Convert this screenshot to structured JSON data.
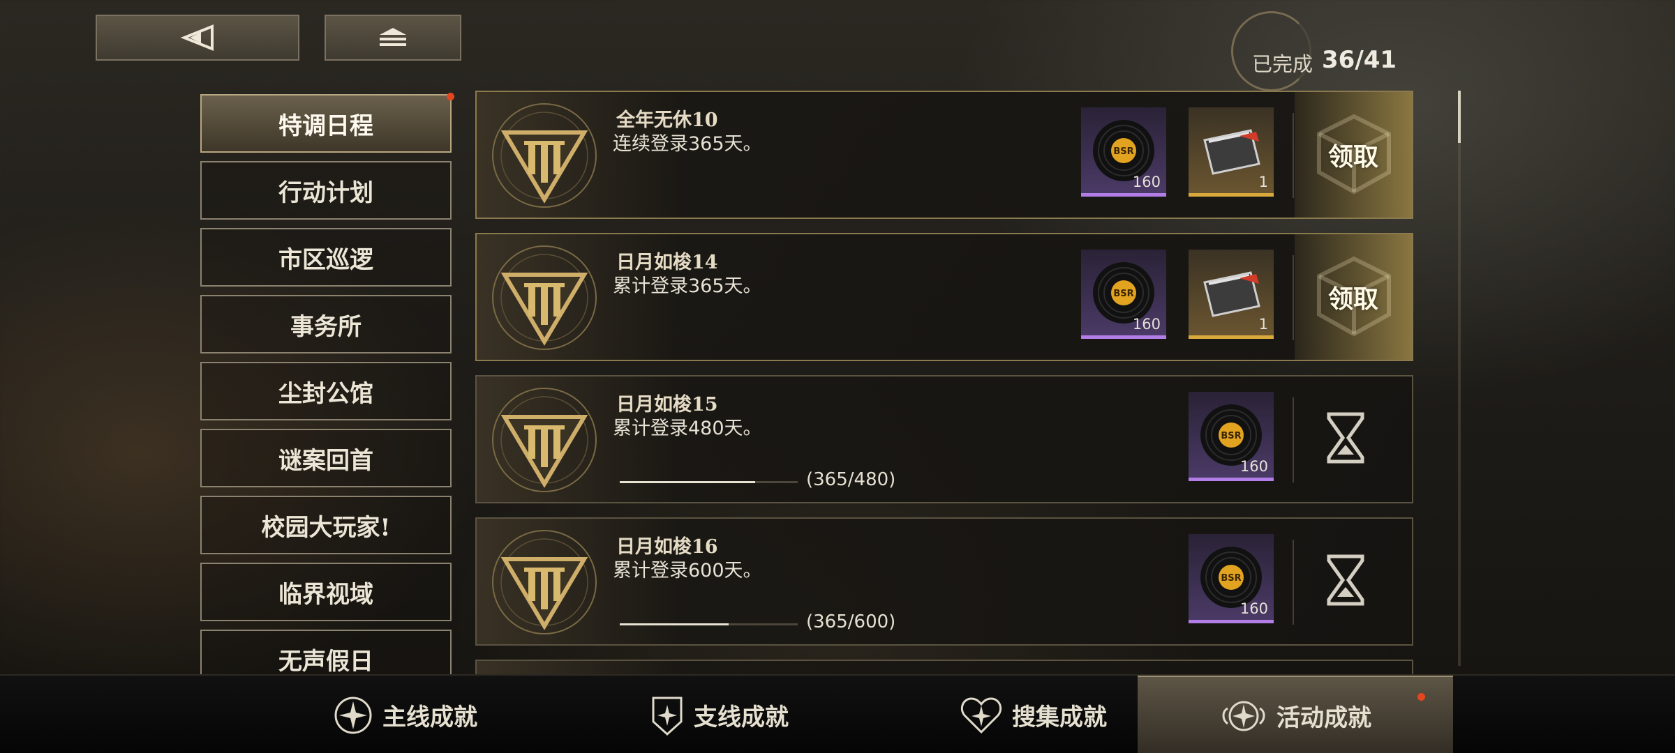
{
  "header": {
    "progress_label": "已完成",
    "progress_value": "36/41"
  },
  "sidebar": {
    "items": [
      {
        "label": "特调日程",
        "active": true,
        "badge": true
      },
      {
        "label": "行动计划"
      },
      {
        "label": "市区巡逻"
      },
      {
        "label": "事务所"
      },
      {
        "label": "尘封公馆"
      },
      {
        "label": "谜案回首"
      },
      {
        "label": "校园大玩家!"
      },
      {
        "label": "临界视域"
      },
      {
        "label": "无声假日"
      }
    ]
  },
  "achievements": [
    {
      "title": "全年无休10",
      "desc": "连续登录365天。",
      "rewards": [
        {
          "type": "record",
          "count": "160"
        },
        {
          "type": "ticket",
          "count": "1"
        }
      ],
      "action": "领取"
    },
    {
      "title": "日月如梭14",
      "desc": "累计登录365天。",
      "rewards": [
        {
          "type": "record",
          "count": "160"
        },
        {
          "type": "ticket",
          "count": "1"
        }
      ],
      "action": "领取"
    },
    {
      "title": "日月如梭15",
      "desc": "累计登录480天。",
      "rewards": [
        {
          "type": "record",
          "count": "160"
        }
      ],
      "progress_text": "(365/480)",
      "progress": 0.76
    },
    {
      "title": "日月如梭16",
      "desc": "累计登录600天。",
      "rewards": [
        {
          "type": "record",
          "count": "160"
        }
      ],
      "progress_text": "(365/600)",
      "progress": 0.61
    }
  ],
  "reward_logo": "BSR",
  "tabs": [
    {
      "label": "主线成就"
    },
    {
      "label": "支线成就"
    },
    {
      "label": "搜集成就"
    },
    {
      "label": "活动成就",
      "active": true,
      "badge": true
    }
  ],
  "colors": {
    "accent_gold": "#c9a458",
    "badge_red": "#e4471f",
    "rarity_purple": "#b27de6",
    "rarity_gold": "#d9a93c"
  },
  "icons": {
    "back": "back-triangle-icon",
    "home": "home-stack-icon",
    "emblem": "triangle-emblem-icon",
    "waiting": "hourglass-icon",
    "record": "vinyl-record-icon",
    "ticket": "ticket-card-icon"
  }
}
